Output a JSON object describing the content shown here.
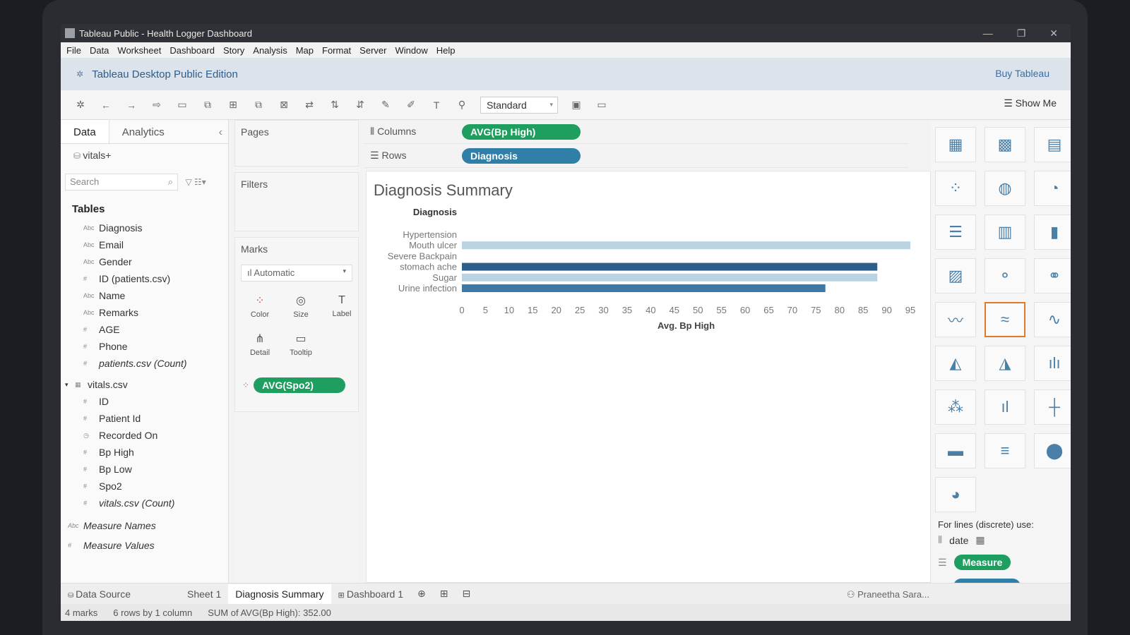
{
  "window": {
    "title": "Tableau Public - Health Logger Dashboard",
    "controls": [
      "—",
      "❐",
      "✕"
    ]
  },
  "menu": [
    "File",
    "Data",
    "Worksheet",
    "Dashboard",
    "Story",
    "Analysis",
    "Map",
    "Format",
    "Server",
    "Window",
    "Help"
  ],
  "edition": {
    "label": "Tableau Desktop Public Edition",
    "buy": "Buy Tableau"
  },
  "toolbar": {
    "view_mode": "Standard",
    "show_me": "Show Me"
  },
  "data_pane": {
    "tabs": [
      "Data",
      "Analytics"
    ],
    "datasource": "vitals+",
    "search_placeholder": "Search",
    "tables_header": "Tables",
    "patients_fields": [
      {
        "type": "Abc",
        "name": "Diagnosis",
        "italic": false
      },
      {
        "type": "Abc",
        "name": "Email",
        "italic": false
      },
      {
        "type": "Abc",
        "name": "Gender",
        "italic": false
      },
      {
        "type": "#",
        "name": "ID (patients.csv)",
        "italic": false
      },
      {
        "type": "Abc",
        "name": "Name",
        "italic": false
      },
      {
        "type": "Abc",
        "name": "Remarks",
        "italic": false
      },
      {
        "type": "#",
        "name": "AGE",
        "italic": false
      },
      {
        "type": "#",
        "name": "Phone",
        "italic": false
      },
      {
        "type": "#",
        "name": "patients.csv (Count)",
        "italic": true
      }
    ],
    "vitals_table": "vitals.csv",
    "vitals_fields": [
      {
        "type": "#",
        "name": "ID",
        "italic": false
      },
      {
        "type": "#",
        "name": "Patient Id",
        "italic": false
      },
      {
        "type": "cal",
        "name": "Recorded On",
        "italic": false
      },
      {
        "type": "#",
        "name": "Bp High",
        "italic": false
      },
      {
        "type": "#",
        "name": "Bp Low",
        "italic": false
      },
      {
        "type": "#",
        "name": "Spo2",
        "italic": false
      },
      {
        "type": "#",
        "name": "vitals.csv (Count)",
        "italic": true
      }
    ],
    "measure_names": "Measure Names",
    "measure_values": "Measure Values"
  },
  "cards": {
    "pages": "Pages",
    "filters": "Filters",
    "marks": "Marks",
    "mark_type": "Automatic",
    "mark_buttons": [
      {
        "label": "Color",
        "icon": "color-icon"
      },
      {
        "label": "Size",
        "icon": "size-icon"
      },
      {
        "label": "Label",
        "icon": "label-icon"
      },
      {
        "label": "Detail",
        "icon": "detail-icon"
      },
      {
        "label": "Tooltip",
        "icon": "tooltip-icon"
      }
    ],
    "color_pill": "AVG(Spo2)"
  },
  "shelves": {
    "columns_label": "Columns",
    "columns_pill": "AVG(Bp High)",
    "rows_label": "Rows",
    "rows_pill": "Diagnosis"
  },
  "viz": {
    "title": "Diagnosis Summary"
  },
  "chart_data": {
    "type": "bar",
    "orientation": "horizontal",
    "title": "Diagnosis Summary",
    "row_header": "Diagnosis",
    "xlabel": "Avg. Bp High",
    "ylabel": "",
    "categories": [
      "Hypertension",
      "Mouth ulcer",
      "Severe Backpain",
      "stomach ache",
      "Sugar",
      "Urine infection"
    ],
    "values": [
      null,
      95,
      null,
      88,
      88,
      77
    ],
    "bar_colors": [
      "#b9d3e3",
      "#b9d3e3",
      "#b9d3e3",
      "#2d5f8a",
      "#b9d3e3",
      "#3f77a6"
    ],
    "xticks": [
      0,
      5,
      10,
      15,
      20,
      25,
      30,
      35,
      40,
      45,
      50,
      55,
      60,
      65,
      70,
      75,
      80,
      85,
      90,
      95
    ],
    "xlim": [
      0,
      95
    ],
    "grid": false
  },
  "show_me": {
    "hint": "For lines (discrete) use:",
    "hint_field": "date",
    "measure": "Measure",
    "dimension": "Dimension",
    "accent": "#e07b28"
  },
  "sheet_tabs": {
    "data_source": "Data Source",
    "tabs": [
      "Sheet 1",
      "Diagnosis Summary",
      "Dashboard 1"
    ],
    "user": "Praneetha Sara..."
  },
  "status": {
    "marks": "4 marks",
    "rows": "6 rows by 1 column",
    "sum": "SUM of AVG(Bp High): 352.00"
  }
}
